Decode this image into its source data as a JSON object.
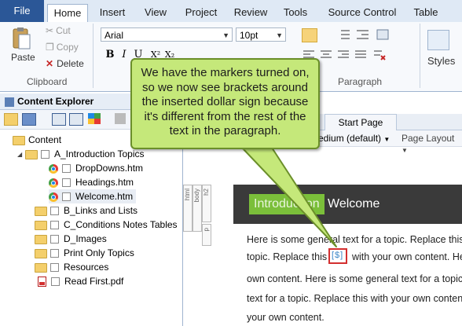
{
  "ribbon_tabs": [
    "File",
    "Home",
    "Insert",
    "View",
    "Project",
    "Review",
    "Tools",
    "Source Control",
    "Table"
  ],
  "active_tab": "Home",
  "clipboard": {
    "paste": "Paste",
    "cut": "Cut",
    "copy": "Copy",
    "delete": "Delete",
    "group_label": "Clipboard"
  },
  "font": {
    "family": "Arial",
    "size": "10pt"
  },
  "paragraph": {
    "group_label": "Paragraph"
  },
  "styles": {
    "label": "Styles"
  },
  "explorer": {
    "title": "Content Explorer",
    "tree": [
      {
        "label": "Content",
        "icon": "folder-icon"
      },
      {
        "label": "A_Introduction Topics",
        "icon": "folder-icon"
      },
      {
        "label": "DropDowns.htm",
        "icon": "chrome-icon"
      },
      {
        "label": "Headings.htm",
        "icon": "chrome-icon"
      },
      {
        "label": "Welcome.htm",
        "icon": "chrome-icon"
      },
      {
        "label": "B_Links and Lists",
        "icon": "folder-icon"
      },
      {
        "label": "C_Conditions Notes Tables",
        "icon": "folder-icon"
      },
      {
        "label": "D_Images",
        "icon": "folder-icon"
      },
      {
        "label": "Print Only Topics",
        "icon": "folder-icon"
      },
      {
        "label": "Resources",
        "icon": "folder-icon"
      },
      {
        "label": "Read First.pdf",
        "icon": "pdf-icon"
      }
    ]
  },
  "editor": {
    "tab": "Start Page",
    "medium": "edium (default)",
    "page_layout": "Page Layout",
    "markers": [
      "html",
      "body",
      "h2",
      "p"
    ],
    "heading_highlight": "Introduction",
    "heading_rest": "Welcome",
    "lines": [
      "Here is some general text for a topic. Replace this",
      "topic. Replace this",
      "with your own content. He",
      "own content. Here is some general text for a topic",
      "text for a topic. Replace this with your own conten",
      "your own content."
    ],
    "inserted": "[$]"
  },
  "callout": {
    "text": "We have the markers turned on, so we now see brackets around the inserted dollar sign because it's different from the rest of the text in the paragraph."
  },
  "colors": {
    "callout_fill": "#c5e87a",
    "callout_border": "#6b8f2a",
    "highlight_box": "#d32f2f",
    "file_tab": "#2b5797"
  }
}
